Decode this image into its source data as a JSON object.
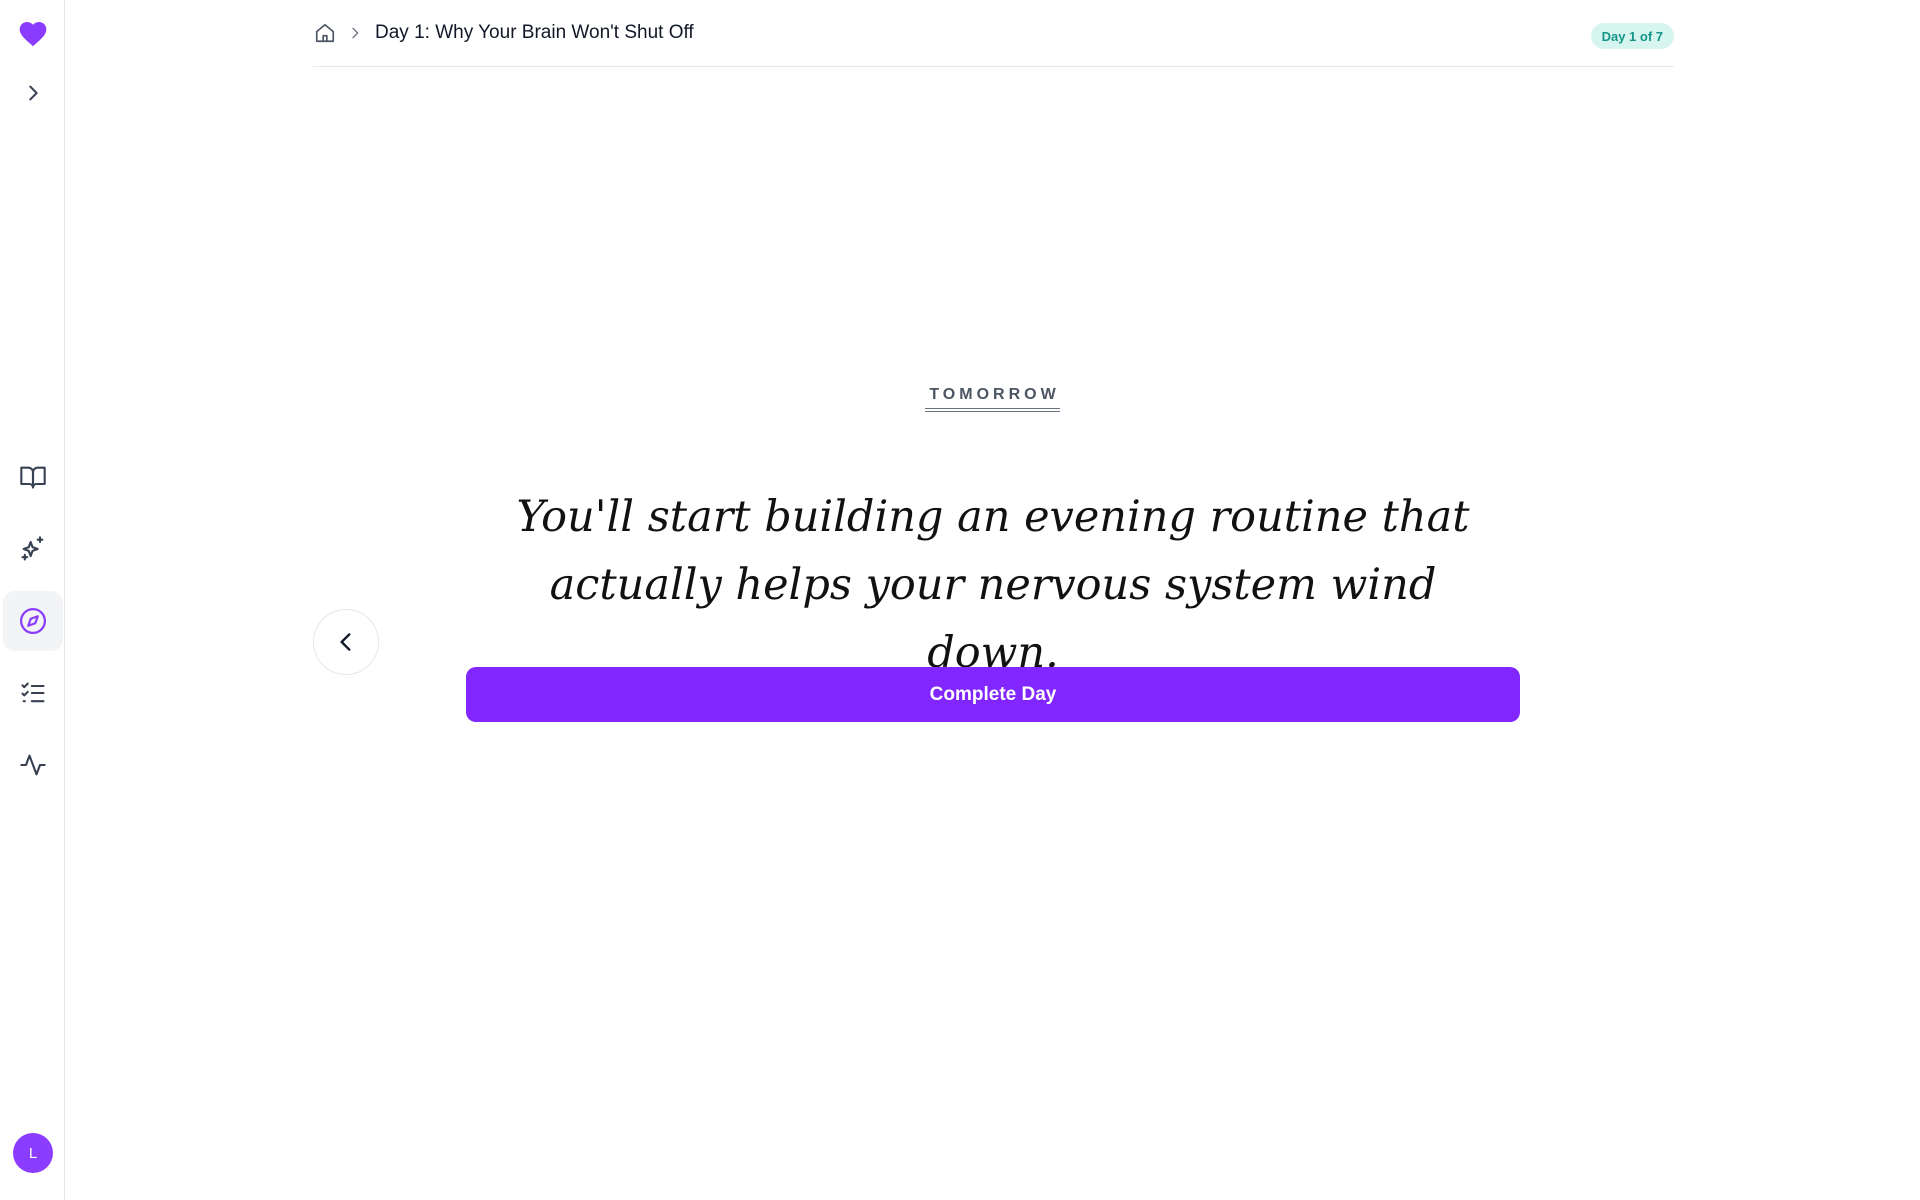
{
  "colors": {
    "brand": "#8126ff",
    "logo": "#8b3dff",
    "badge_bg": "#d7f5ef",
    "badge_text": "#14958a",
    "active_nav_bg": "#f3f4f6"
  },
  "sidebar": {
    "logo_icon": "heart-icon",
    "expand_icon": "chevron-right-icon",
    "items": [
      {
        "icon": "book-open-icon",
        "active": false
      },
      {
        "icon": "sparkles-icon",
        "active": false
      },
      {
        "icon": "compass-icon",
        "active": true
      },
      {
        "icon": "checklist-icon",
        "active": false
      },
      {
        "icon": "activity-icon",
        "active": false
      }
    ],
    "avatar_initial": "L"
  },
  "header": {
    "home_icon": "home-icon",
    "separator_icon": "chevron-right-icon",
    "title": "Day 1: Why Your Brain Won't Shut Off",
    "badge": "Day 1 of 7"
  },
  "main": {
    "eyebrow": "TOMORROW",
    "headline_line1": "You'll start building an evening routine that",
    "headline_line2": "actually helps your nervous system wind down.",
    "back_icon": "chevron-left-icon",
    "complete_label": "Complete Day"
  }
}
